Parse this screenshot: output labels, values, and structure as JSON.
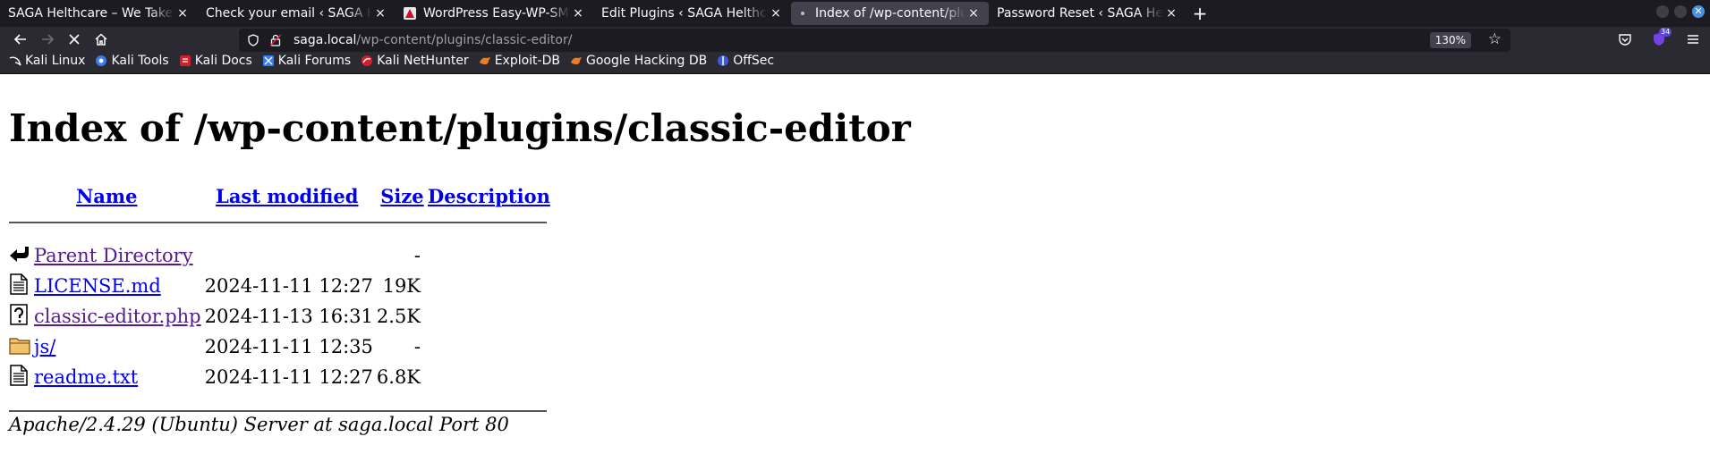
{
  "tabs": [
    {
      "title": "SAGA Helthcare – We Take ca",
      "active": false
    },
    {
      "title": "Check your email ‹ SAGA Helt",
      "active": false
    },
    {
      "title": "WordPress Easy-WP-SMT",
      "active": false
    },
    {
      "title": "Edit Plugins ‹ SAGA Helthcare",
      "active": false
    },
    {
      "title": "Index of /wp-content/plug",
      "active": true
    },
    {
      "title": "Password Reset ‹ SAGA Helth",
      "active": false
    }
  ],
  "tab_close_glyph": "×",
  "new_tab_glyph": "+",
  "navbar": {
    "url_host": "saga.local",
    "url_path": "/wp-content/plugins/classic-editor/",
    "zoom": "130%",
    "extension_badge": "34"
  },
  "bookmarks": [
    {
      "label": "Kali Linux",
      "icon": "kali-dragon-icon"
    },
    {
      "label": "Kali Tools",
      "icon": "kali-tools-icon"
    },
    {
      "label": "Kali Docs",
      "icon": "kali-docs-icon"
    },
    {
      "label": "Kali Forums",
      "icon": "kali-forums-icon"
    },
    {
      "label": "Kali NetHunter",
      "icon": "nethunter-icon"
    },
    {
      "label": "Exploit-DB",
      "icon": "exploit-db-icon"
    },
    {
      "label": "Google Hacking DB",
      "icon": "ghdb-icon"
    },
    {
      "label": "OffSec",
      "icon": "offsec-icon"
    }
  ],
  "page": {
    "heading": "Index of /wp-content/plugins/classic-editor",
    "columns": {
      "name": "Name",
      "last_modified": "Last modified",
      "size": "Size",
      "description": "Description"
    },
    "rows": [
      {
        "icon": "parent-directory-icon",
        "name": "Parent Directory",
        "modified": "",
        "size": "-",
        "visited": true
      },
      {
        "icon": "text-file-icon",
        "name": "LICENSE.md",
        "modified": "2024-11-11 12:27",
        "size": "19K",
        "visited": false
      },
      {
        "icon": "unknown-file-icon",
        "name": "classic-editor.php",
        "modified": "2024-11-13 16:31",
        "size": "2.5K",
        "visited": true
      },
      {
        "icon": "folder-icon",
        "name": "js/",
        "modified": "2024-11-11 12:35",
        "size": "-",
        "visited": false
      },
      {
        "icon": "text-file-icon",
        "name": "readme.txt",
        "modified": "2024-11-11 12:27",
        "size": "6.8K",
        "visited": false
      }
    ],
    "footer": "Apache/2.4.29 (Ubuntu) Server at saga.local Port 80"
  },
  "colors": {
    "link": "#0000ee",
    "visited_link": "#551a8b",
    "chrome_dark": "#1c1b22",
    "toolbar": "#2b2a33"
  }
}
